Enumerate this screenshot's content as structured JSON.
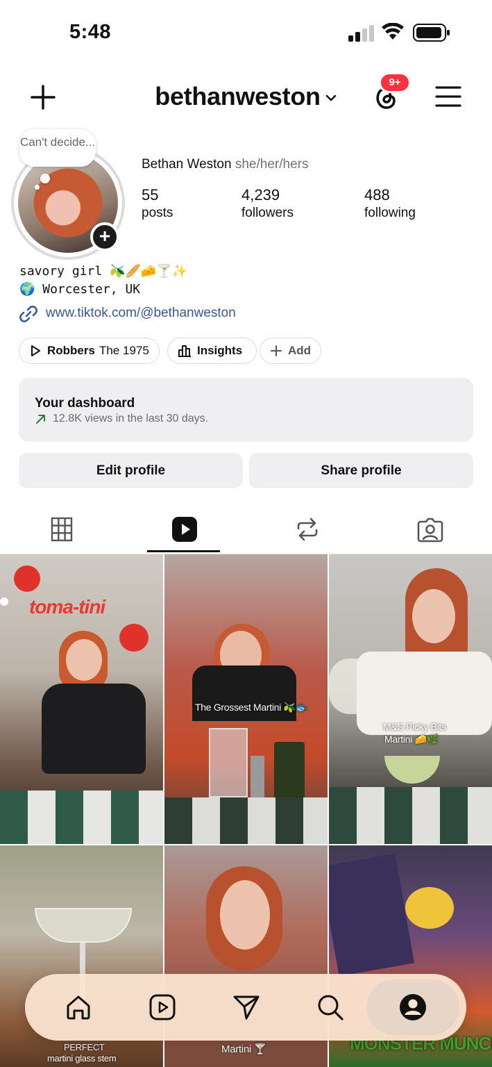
{
  "status_bar": {
    "time": "5:48"
  },
  "header": {
    "username": "bethanweston",
    "notification_badge": "9+"
  },
  "profile": {
    "note": "Can't decide...",
    "full_name": "Bethan Weston",
    "pronouns": "she/her/hers",
    "stats": [
      {
        "value": "55",
        "label": "posts"
      },
      {
        "value": "4,239",
        "label": "followers"
      },
      {
        "value": "488",
        "label": "following"
      }
    ],
    "bio_line1": "savory girl 🫒🥖🧀🍸✨",
    "bio_line2": "🌍 Worcester, UK",
    "link": "www.tiktok.com/@bethanweston"
  },
  "chips": {
    "music_title": "Robbers",
    "music_artist": "The 1975",
    "insights": "Insights",
    "add": "Add"
  },
  "dashboard": {
    "title": "Your dashboard",
    "subtitle": "12.8K views in the last 30 days."
  },
  "actions": {
    "edit": "Edit profile",
    "share": "Share profile"
  },
  "tabs": [
    "grid",
    "reels",
    "reposts",
    "tagged"
  ],
  "grid": {
    "captions": {
      "p1": "toma-tini",
      "p2": "The Grossest Martini 🫒🐟",
      "p3_line1": "M&S Picky Bits",
      "p3_line2": "Martini 🧀🌿",
      "p4_line1": "PERFECT",
      "p4_line2": "martini glass stem",
      "p5": "Martini 🍸",
      "p6": "MONSTER MUNCH"
    }
  },
  "colors": {
    "badge": "#ff3040",
    "link": "#385898",
    "card_bg": "#efeff1",
    "nav_bg": "#fae4d0"
  }
}
